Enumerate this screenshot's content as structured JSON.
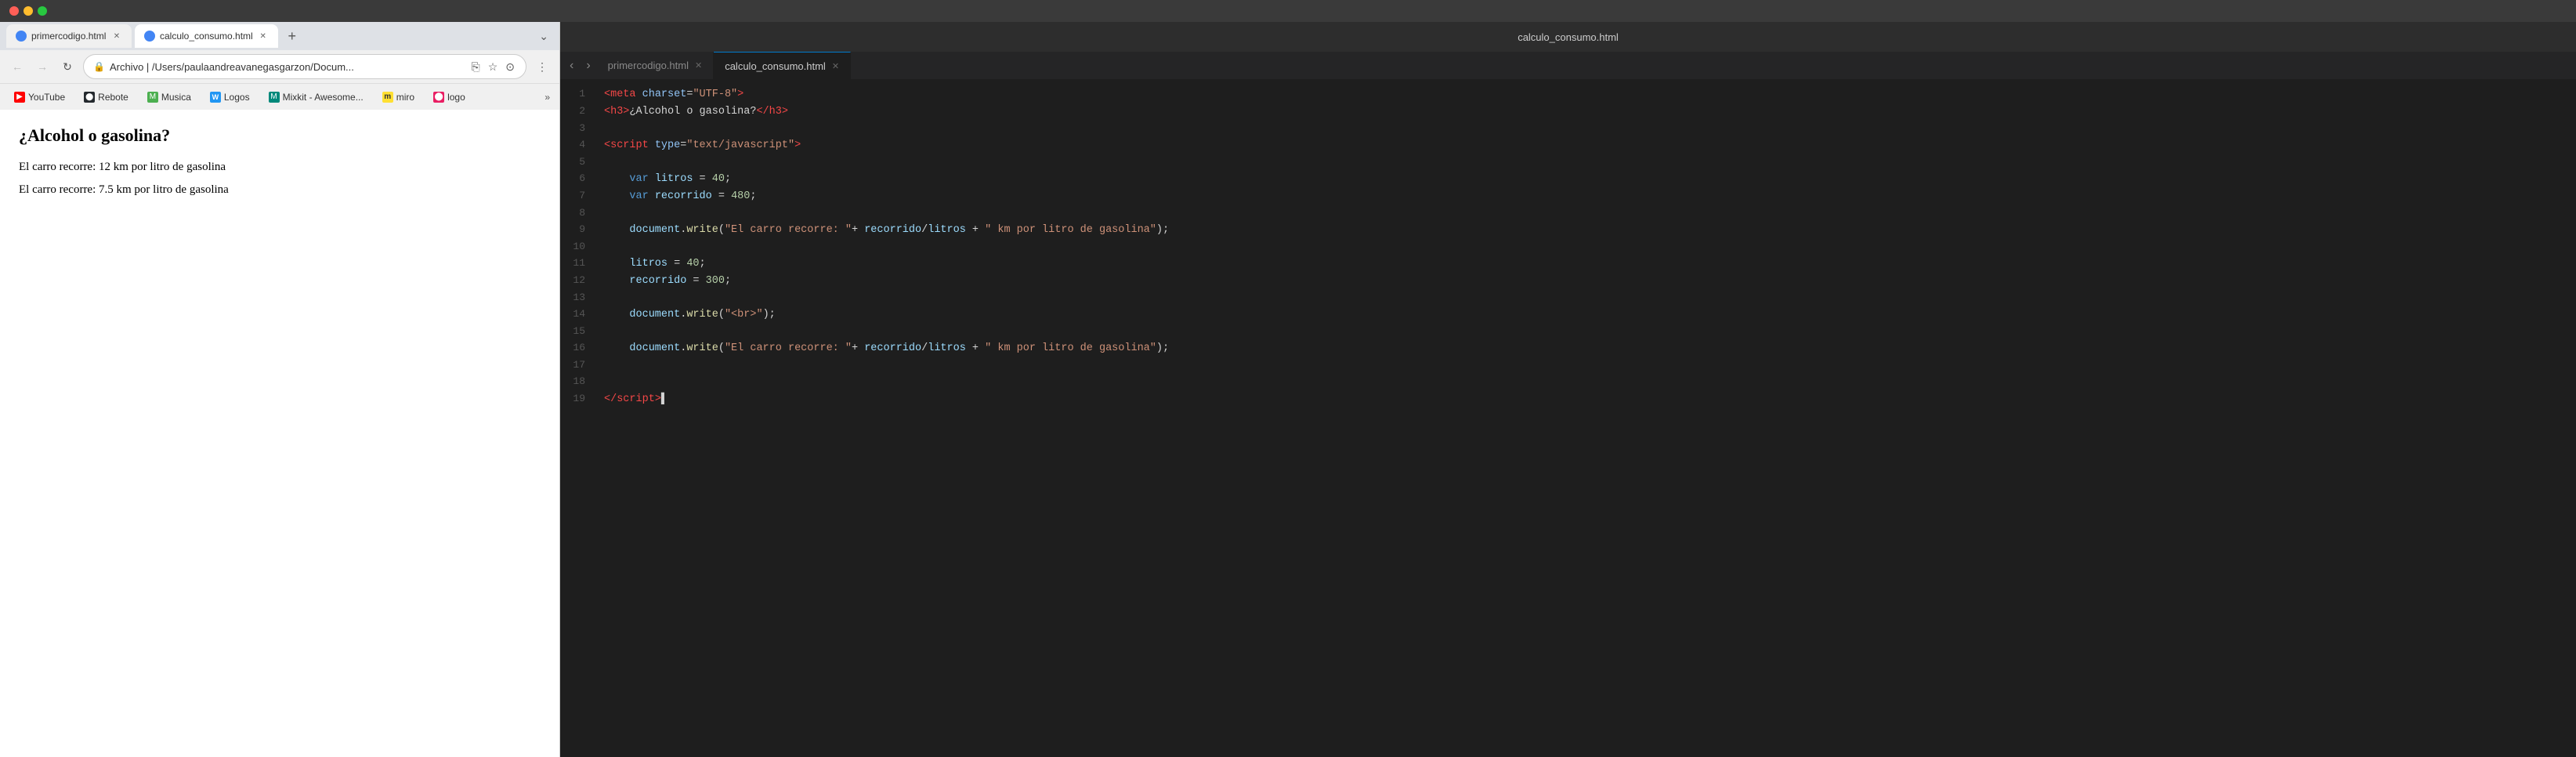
{
  "titleBar": {
    "trafficLights": [
      "red",
      "yellow",
      "green"
    ]
  },
  "browser": {
    "tabs": [
      {
        "id": "tab1",
        "label": "primercodigo.html",
        "active": false
      },
      {
        "id": "tab2",
        "label": "calculo_consumo.html",
        "active": true
      }
    ],
    "addressBar": {
      "url": "Archivo  | /Users/paulaandreavanegasgarzon/Docum...",
      "lock": "🔒"
    },
    "bookmarks": [
      {
        "id": "yt",
        "label": "YouTube",
        "iconClass": "yt-icon",
        "iconText": "▶"
      },
      {
        "id": "gh",
        "label": "Rebote",
        "iconClass": "gh-icon",
        "iconText": "●"
      },
      {
        "id": "musica",
        "label": "Musica",
        "iconClass": "bm-icon-green",
        "iconText": "M"
      },
      {
        "id": "logos",
        "label": "Logos",
        "iconClass": "bm-icon-blue",
        "iconText": "W"
      },
      {
        "id": "mixkit",
        "label": "Mixkit - Awesome...",
        "iconClass": "bm-icon-teal",
        "iconText": "M"
      },
      {
        "id": "miro",
        "label": "miro",
        "iconClass": "bm-icon-miro",
        "iconText": "m"
      },
      {
        "id": "logo",
        "label": "logo",
        "iconClass": "bm-icon-logo",
        "iconText": "●"
      }
    ],
    "content": {
      "heading": "¿Alcohol o gasolina?",
      "lines": [
        "El carro recorre: 12 km por litro de gasolina",
        "El carro recorre: 7.5 km por litro de gasolina"
      ]
    }
  },
  "editor": {
    "title": "calculo_consumo.html",
    "tabs": [
      {
        "id": "tab1",
        "label": "primercodigo.html",
        "active": false,
        "modified": false
      },
      {
        "id": "tab2",
        "label": "calculo_consumo.html",
        "active": true,
        "modified": false
      }
    ],
    "lines": [
      {
        "num": 1,
        "tokens": [
          {
            "cls": "kw-tag",
            "text": "<meta"
          },
          {
            "cls": "kw-attr",
            "text": " charset"
          },
          {
            "cls": "kw-punct",
            "text": "="
          },
          {
            "cls": "kw-val",
            "text": "\"UTF-8\""
          },
          {
            "cls": "kw-tag",
            "text": ">"
          }
        ]
      },
      {
        "num": 2,
        "tokens": [
          {
            "cls": "kw-tag",
            "text": "<h3>"
          },
          {
            "cls": "kw-white",
            "text": "¿Alcohol o gasolina?"
          },
          {
            "cls": "kw-tag",
            "text": "</h3>"
          }
        ]
      },
      {
        "num": 3,
        "tokens": []
      },
      {
        "num": 4,
        "tokens": [
          {
            "cls": "kw-tag",
            "text": "<script"
          },
          {
            "cls": "kw-attr",
            "text": " type"
          },
          {
            "cls": "kw-punct",
            "text": "="
          },
          {
            "cls": "kw-val",
            "text": "\"text/javascript\""
          },
          {
            "cls": "kw-tag",
            "text": ">"
          }
        ]
      },
      {
        "num": 5,
        "tokens": []
      },
      {
        "num": 6,
        "tokens": [
          {
            "cls": "kw-white",
            "text": "    "
          },
          {
            "cls": "kw-blue",
            "text": "var"
          },
          {
            "cls": "kw-white",
            "text": " "
          },
          {
            "cls": "kw-cyan",
            "text": "litros"
          },
          {
            "cls": "kw-white",
            "text": " = "
          },
          {
            "cls": "kw-num",
            "text": "40"
          },
          {
            "cls": "kw-white",
            "text": ";"
          }
        ]
      },
      {
        "num": 7,
        "tokens": [
          {
            "cls": "kw-white",
            "text": "    "
          },
          {
            "cls": "kw-blue",
            "text": "var"
          },
          {
            "cls": "kw-white",
            "text": " "
          },
          {
            "cls": "kw-cyan",
            "text": "recorrido"
          },
          {
            "cls": "kw-white",
            "text": " = "
          },
          {
            "cls": "kw-num",
            "text": "480"
          },
          {
            "cls": "kw-white",
            "text": ";"
          }
        ]
      },
      {
        "num": 8,
        "tokens": []
      },
      {
        "num": 9,
        "tokens": [
          {
            "cls": "kw-white",
            "text": "    "
          },
          {
            "cls": "kw-cyan",
            "text": "document"
          },
          {
            "cls": "kw-white",
            "text": "."
          },
          {
            "cls": "kw-method",
            "text": "write"
          },
          {
            "cls": "kw-white",
            "text": "("
          },
          {
            "cls": "kw-str",
            "text": "\"El carro recorre: \""
          },
          {
            "cls": "kw-white",
            "text": "+ "
          },
          {
            "cls": "kw-cyan",
            "text": "recorrido"
          },
          {
            "cls": "kw-white",
            "text": "/"
          },
          {
            "cls": "kw-cyan",
            "text": "litros"
          },
          {
            "cls": "kw-white",
            "text": " + "
          },
          {
            "cls": "kw-str",
            "text": "\" km por litro de gasolina\""
          },
          {
            "cls": "kw-white",
            "text": ");"
          }
        ]
      },
      {
        "num": 10,
        "tokens": []
      },
      {
        "num": 11,
        "tokens": [
          {
            "cls": "kw-white",
            "text": "    "
          },
          {
            "cls": "kw-cyan",
            "text": "litros"
          },
          {
            "cls": "kw-white",
            "text": " = "
          },
          {
            "cls": "kw-num",
            "text": "40"
          },
          {
            "cls": "kw-white",
            "text": ";"
          }
        ]
      },
      {
        "num": 12,
        "tokens": [
          {
            "cls": "kw-white",
            "text": "    "
          },
          {
            "cls": "kw-cyan",
            "text": "recorrido"
          },
          {
            "cls": "kw-white",
            "text": " = "
          },
          {
            "cls": "kw-num",
            "text": "300"
          },
          {
            "cls": "kw-white",
            "text": ";"
          }
        ]
      },
      {
        "num": 13,
        "tokens": []
      },
      {
        "num": 14,
        "tokens": [
          {
            "cls": "kw-white",
            "text": "    "
          },
          {
            "cls": "kw-cyan",
            "text": "document"
          },
          {
            "cls": "kw-white",
            "text": "."
          },
          {
            "cls": "kw-method",
            "text": "write"
          },
          {
            "cls": "kw-white",
            "text": "("
          },
          {
            "cls": "kw-str",
            "text": "\"<br>\""
          },
          {
            "cls": "kw-white",
            "text": ");"
          }
        ]
      },
      {
        "num": 15,
        "tokens": []
      },
      {
        "num": 16,
        "tokens": [
          {
            "cls": "kw-white",
            "text": "    "
          },
          {
            "cls": "kw-cyan",
            "text": "document"
          },
          {
            "cls": "kw-white",
            "text": "."
          },
          {
            "cls": "kw-method",
            "text": "write"
          },
          {
            "cls": "kw-white",
            "text": "("
          },
          {
            "cls": "kw-str",
            "text": "\"El carro recorre: \""
          },
          {
            "cls": "kw-white",
            "text": "+ "
          },
          {
            "cls": "kw-cyan",
            "text": "recorrido"
          },
          {
            "cls": "kw-white",
            "text": "/"
          },
          {
            "cls": "kw-cyan",
            "text": "litros"
          },
          {
            "cls": "kw-white",
            "text": " + "
          },
          {
            "cls": "kw-str",
            "text": "\" km por litro de gasolina\""
          },
          {
            "cls": "kw-white",
            "text": ");"
          }
        ]
      },
      {
        "num": 17,
        "tokens": []
      },
      {
        "num": 18,
        "tokens": []
      },
      {
        "num": 19,
        "tokens": [
          {
            "cls": "kw-tag",
            "text": "</"
          },
          {
            "cls": "kw-script-tag",
            "text": "script"
          },
          {
            "cls": "kw-tag",
            "text": ">"
          },
          {
            "cls": "kw-white",
            "text": "▌"
          }
        ]
      }
    ]
  }
}
